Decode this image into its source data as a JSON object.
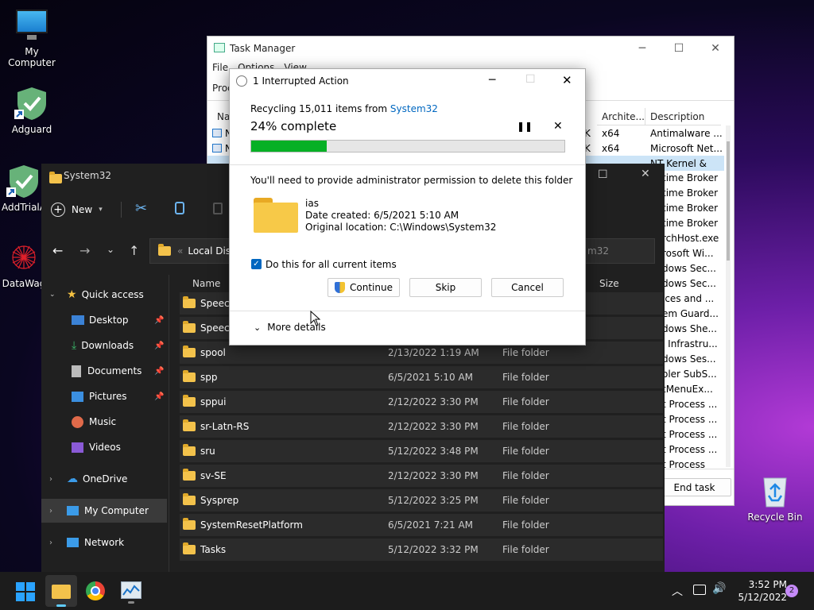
{
  "desktop": {
    "icons": [
      {
        "label": "My Computer"
      },
      {
        "label": "Adguard"
      },
      {
        "label": "AddTrialA"
      },
      {
        "label": "DataWag"
      },
      {
        "label": "Recycle Bin"
      }
    ]
  },
  "task_manager": {
    "title": "Task Manager",
    "menu": [
      "File",
      "Options",
      "View"
    ],
    "tab_partial": "Proc",
    "col_name": "Nar",
    "col_arch": "Archite...",
    "col_desc": "Description",
    "end_task": "End task",
    "rows": [
      {
        "arch": "x64",
        "desc": "Antimalware ..."
      },
      {
        "arch": "x64",
        "desc": "Microsoft Net..."
      },
      {
        "arch": "",
        "desc": "NT Kernel & S..."
      }
    ],
    "desc_rows": [
      "time Broker",
      "time Broker",
      "time Broker",
      "time Broker",
      "rchHost.exe",
      "rosoft Wi...",
      "dows Sec...",
      "dows Sec...",
      "ices and ...",
      "em Guard...",
      "dows She...",
      "l Infrastru...",
      "dows Ses...",
      "oler SubS...",
      "tMenuEx...",
      "t Process ...",
      "t Process ...",
      "t Process ...",
      "t Process ...",
      "t Process"
    ]
  },
  "explorer": {
    "title": "System32",
    "new_label": "New",
    "address": "Local Disk",
    "address_prefix": "«",
    "search_partial": "m32",
    "col_name": "Name",
    "col_size": "Size",
    "sidebar": [
      {
        "label": "Quick access"
      },
      {
        "label": "Desktop"
      },
      {
        "label": "Downloads"
      },
      {
        "label": "Documents"
      },
      {
        "label": "Pictures"
      },
      {
        "label": "Music"
      },
      {
        "label": "Videos"
      },
      {
        "label": "OneDrive"
      },
      {
        "label": "My Computer"
      },
      {
        "label": "Network"
      }
    ],
    "files": [
      {
        "name": "Speech",
        "date": "",
        "type": ""
      },
      {
        "name": "Speech",
        "date": "",
        "type": ""
      },
      {
        "name": "spool",
        "date": "2/13/2022 1:19 AM",
        "type": "File folder"
      },
      {
        "name": "spp",
        "date": "6/5/2021 5:10 AM",
        "type": "File folder"
      },
      {
        "name": "sppui",
        "date": "2/12/2022 3:30 PM",
        "type": "File folder"
      },
      {
        "name": "sr-Latn-RS",
        "date": "2/12/2022 3:30 PM",
        "type": "File folder"
      },
      {
        "name": "sru",
        "date": "5/12/2022 3:48 PM",
        "type": "File folder"
      },
      {
        "name": "sv-SE",
        "date": "2/12/2022 3:30 PM",
        "type": "File folder"
      },
      {
        "name": "Sysprep",
        "date": "5/12/2022 3:25 PM",
        "type": "File folder"
      },
      {
        "name": "SystemResetPlatform",
        "date": "6/5/2021 7:21 AM",
        "type": "File folder"
      },
      {
        "name": "Tasks",
        "date": "5/12/2022 3:32 PM",
        "type": "File folder"
      }
    ]
  },
  "dialog": {
    "title": "1 Interrupted Action",
    "recycling_prefix": "Recycling 15,011 items from ",
    "recycling_link": "System32",
    "progress_text": "24% complete",
    "progress": 0.24,
    "message": "You'll need to provide administrator permission to delete this folder",
    "item_name": "ias",
    "item_date": "Date created: 6/5/2021 5:10 AM",
    "item_location": "Original location: C:\\Windows\\System32",
    "checkbox_label": "Do this for all current items",
    "checkbox_checked": true,
    "continue": "Continue",
    "skip": "Skip",
    "cancel": "Cancel",
    "more_details": "More details"
  },
  "taskbar": {
    "time": "3:52 PM",
    "date": "5/12/2022",
    "notifications": "2"
  },
  "colors": {
    "accent": "#0067c0",
    "progress": "#06b025",
    "folder": "#f3c24b"
  }
}
